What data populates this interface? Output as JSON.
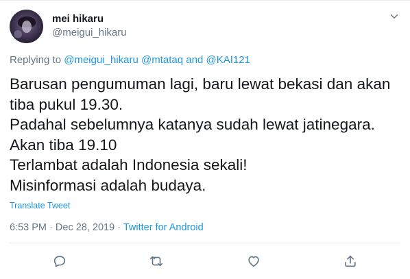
{
  "user": {
    "display_name": "mei hikaru",
    "handle": "@meigui_hikaru",
    "avatar_icon": "profile-photo"
  },
  "reply": {
    "prefix": "Replying to",
    "mentions": [
      "@meigui_hikaru",
      "@mtataq"
    ],
    "conjunction": "and",
    "last_mention": "@KAI121"
  },
  "tweet": {
    "lines": [
      "Barusan pengumuman lagi, baru lewat bekasi dan akan",
      "tiba pukul 19.30.",
      "Padahal sebelumnya katanya sudah lewat jatinegara.",
      "Akan tiba 19.10",
      "Terlambat adalah Indonesia sekali!",
      "Misinformasi adalah budaya."
    ],
    "translate_label": "Translate Tweet"
  },
  "meta": {
    "time": "6:53 PM",
    "separator": "·",
    "date": "Dec 28, 2019",
    "source": "Twitter for Android"
  },
  "actions": [
    "reply-icon",
    "retweet-icon",
    "like-icon",
    "share-icon"
  ],
  "colors": {
    "link": "#1b95e0",
    "muted": "#657786",
    "text": "#14171a",
    "divider": "#e6ecf0"
  }
}
